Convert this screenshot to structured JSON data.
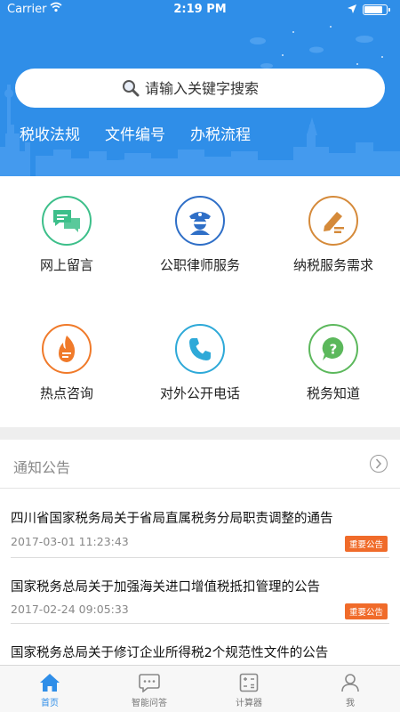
{
  "status_bar": {
    "carrier": "Carrier",
    "time": "2:19 PM",
    "battery_level": 0.9
  },
  "search": {
    "placeholder": "请输入关键字搜索"
  },
  "quick_links": [
    "税收法规",
    "文件编号",
    "办税流程"
  ],
  "services": [
    {
      "label": "网上留言",
      "icon": "chat-bubbles-icon",
      "color": "#3dbf8a"
    },
    {
      "label": "公职律师服务",
      "icon": "officer-icon",
      "color": "#2f6fc7"
    },
    {
      "label": "纳税服务需求",
      "icon": "pen-edit-icon",
      "color": "#d58a3a"
    },
    {
      "label": "热点咨询",
      "icon": "flame-icon",
      "color": "#f07a2a"
    },
    {
      "label": "对外公开电话",
      "icon": "phone-icon",
      "color": "#2ea9d8"
    },
    {
      "label": "税务知道",
      "icon": "question-bubble-icon",
      "color": "#5cb85c"
    }
  ],
  "notices_section": {
    "title": "通知公告"
  },
  "notices": [
    {
      "title": "四川省国家税务局关于省局直属税务分局职责调整的通告",
      "date": "2017-03-01 11:23:43",
      "badge": "重要公告"
    },
    {
      "title": "国家税务总局关于加强海关进口增值税抵扣管理的公告",
      "date": "2017-02-24 09:05:33",
      "badge": "重要公告"
    },
    {
      "title": "国家税务总局关于修订企业所得税2个规范性文件的公告"
    }
  ],
  "tabs": [
    {
      "label": "首页",
      "icon": "home-icon",
      "active": true
    },
    {
      "label": "智能问答",
      "icon": "chat-icon",
      "active": false
    },
    {
      "label": "计算器",
      "icon": "calculator-icon",
      "active": false
    },
    {
      "label": "我",
      "icon": "user-icon",
      "active": false
    }
  ],
  "colors": {
    "header_blue": "#2f8ee8",
    "badge_orange": "#f06b2a"
  }
}
